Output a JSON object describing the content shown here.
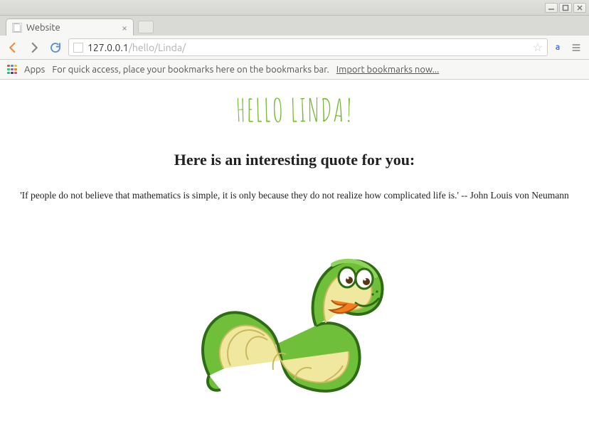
{
  "window": {
    "tab_title": "Website"
  },
  "address": {
    "host": "127.0.0.1",
    "path": "/hello/Linda/"
  },
  "bookmarks_bar": {
    "apps_label": "Apps",
    "hint": "For quick access, place your bookmarks here on the bookmarks bar.",
    "import_label": "Import bookmarks now..."
  },
  "page": {
    "heading": "Hello Linda!",
    "subheading": "Here is an interesting quote for you:",
    "quote": "'If people do not believe that mathematics is simple, it is only because they do not realize how complicated life is.' -- John Louis von Neumann"
  }
}
